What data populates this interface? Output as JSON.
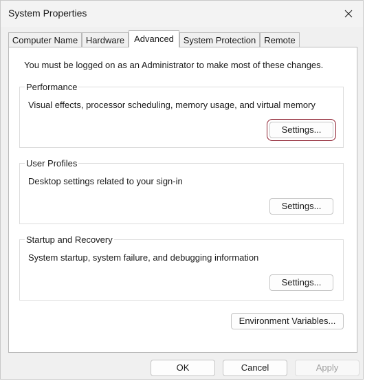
{
  "window": {
    "title": "System Properties"
  },
  "tabs": [
    {
      "label": "Computer Name",
      "active": false
    },
    {
      "label": "Hardware",
      "active": false
    },
    {
      "label": "Advanced",
      "active": true
    },
    {
      "label": "System Protection",
      "active": false
    },
    {
      "label": "Remote",
      "active": false
    }
  ],
  "notice": "You must be logged on as an Administrator to make most of these changes.",
  "groups": {
    "performance": {
      "label": "Performance",
      "description": "Visual effects, processor scheduling, memory usage, and virtual memory",
      "button": "Settings..."
    },
    "user_profiles": {
      "label": "User Profiles",
      "description": "Desktop settings related to your sign-in",
      "button": "Settings..."
    },
    "startup_recovery": {
      "label": "Startup and Recovery",
      "description": "System startup, system failure, and debugging information",
      "button": "Settings..."
    }
  },
  "environment_button": "Environment Variables...",
  "footer": {
    "ok": "OK",
    "cancel": "Cancel",
    "apply": "Apply"
  },
  "icons": {
    "close": "close-icon"
  },
  "colors": {
    "focus_outline": "#8b1a2b",
    "disabled_text": "#a0a0a0"
  }
}
